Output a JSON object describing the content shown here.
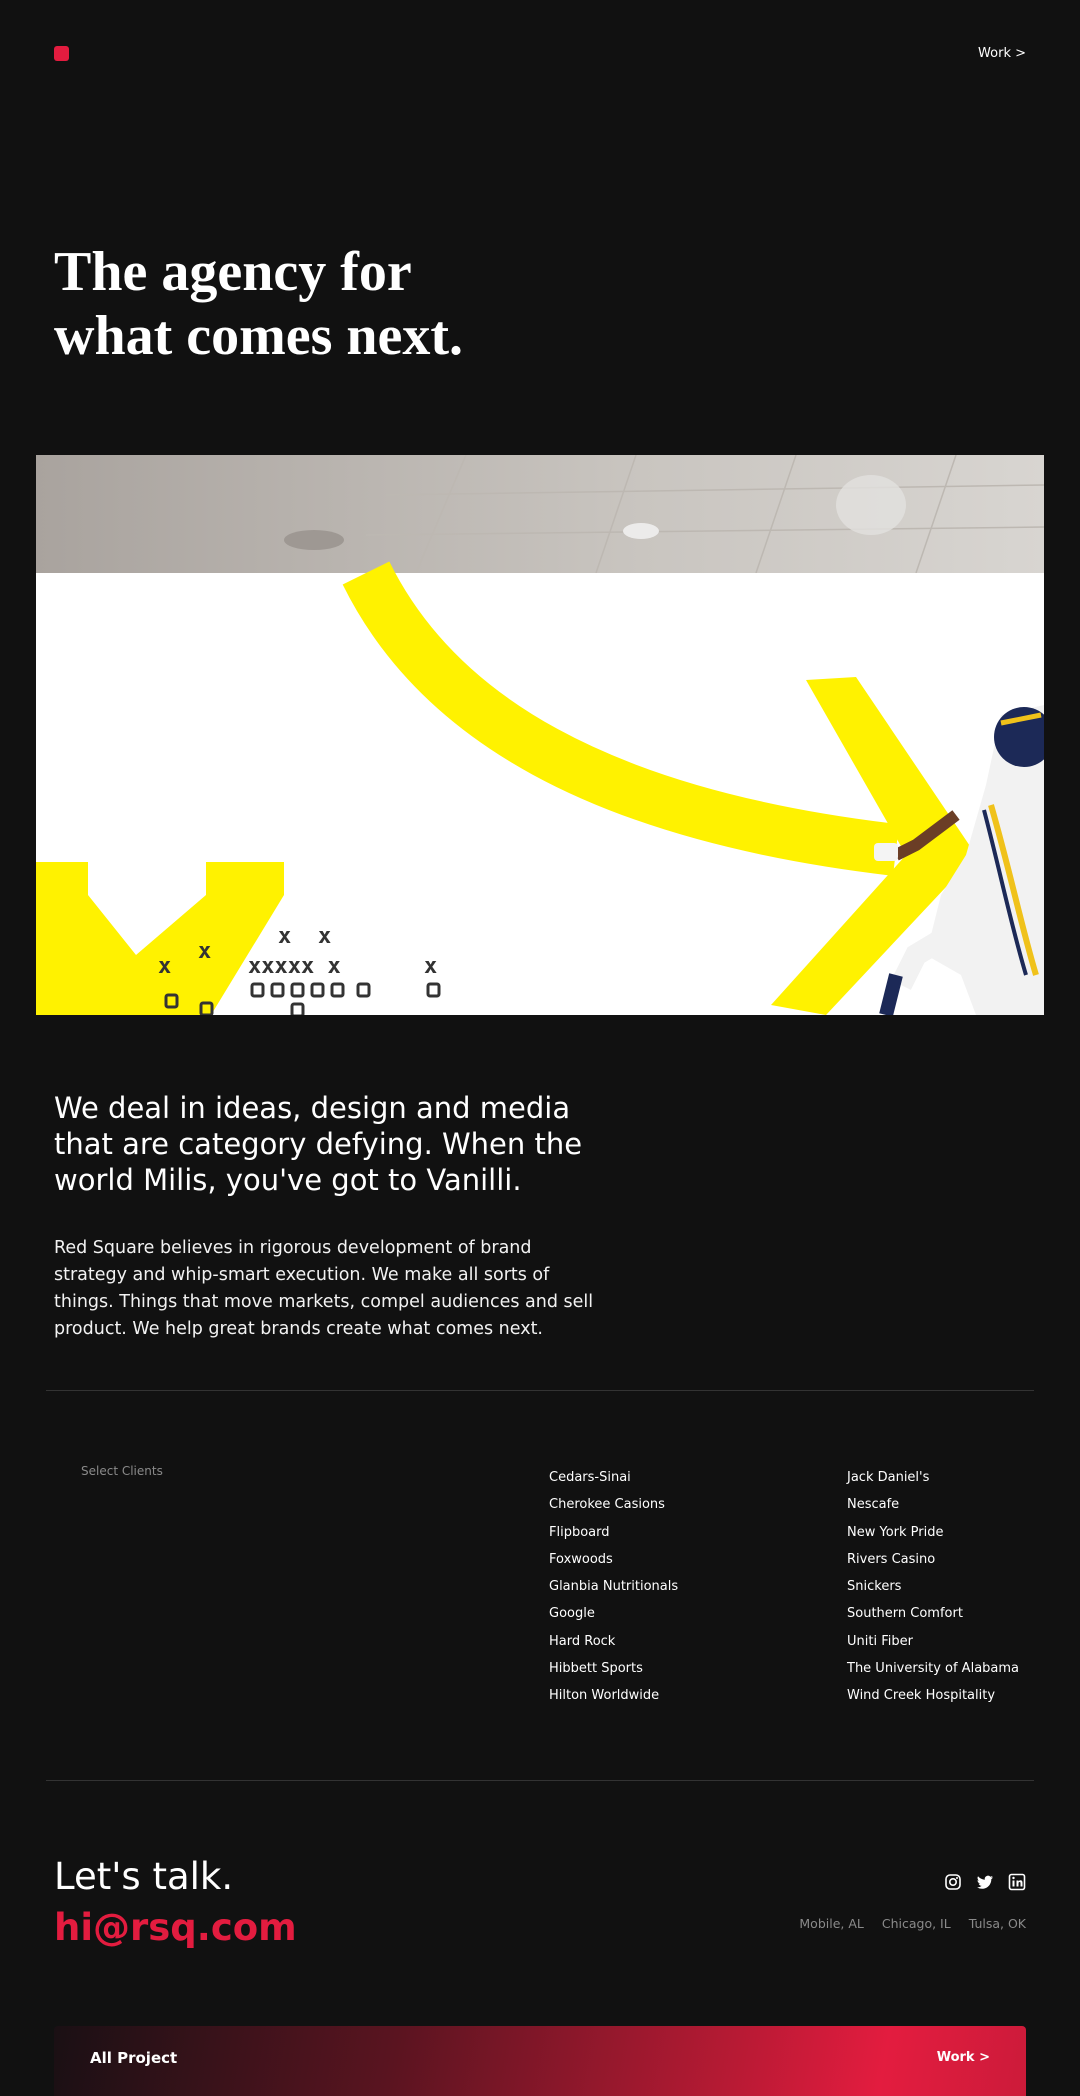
{
  "header": {
    "nav_work": "Work >"
  },
  "hero": {
    "title_line1": "The agency for",
    "title_line2": "what comes next."
  },
  "intro": {
    "heading": "We deal in ideas, design and media that are category defying. When the world Milis, you've got to Vanilli.",
    "body": "Red Square believes in rigorous development of brand strategy and whip-smart execution. We make all sorts of things. Things that move markets, compel audiences and sell product. We help great brands create what comes next."
  },
  "clients": {
    "label": "Select Clients",
    "column1": [
      "Cedars-Sinai",
      "Cherokee Casions",
      "Flipboard",
      "Foxwoods",
      "Glanbia Nutritionals",
      "Google",
      "Hard Rock",
      "Hibbett Sports",
      "Hilton Worldwide"
    ],
    "column2": [
      "Jack Daniel's",
      "Nescafe",
      "New York Pride",
      "Rivers Casino",
      "Snickers",
      "Southern Comfort",
      "Uniti Fiber",
      "The University of Alabama",
      "Wind Creek Hospitality"
    ]
  },
  "contact": {
    "heading": "Let's talk.",
    "email": "hi@rsq.com",
    "social_icons": [
      "instagram-icon",
      "twitter-icon",
      "linkedin-icon"
    ],
    "cities": [
      "Mobile, AL",
      "Chicago, IL",
      "Tulsa, OK"
    ]
  },
  "footer": {
    "left_label": "All Project",
    "right_label": "Work >"
  },
  "colors": {
    "background": "#111111",
    "accent": "#e31c3f",
    "graphic_yellow": "#fff200"
  }
}
